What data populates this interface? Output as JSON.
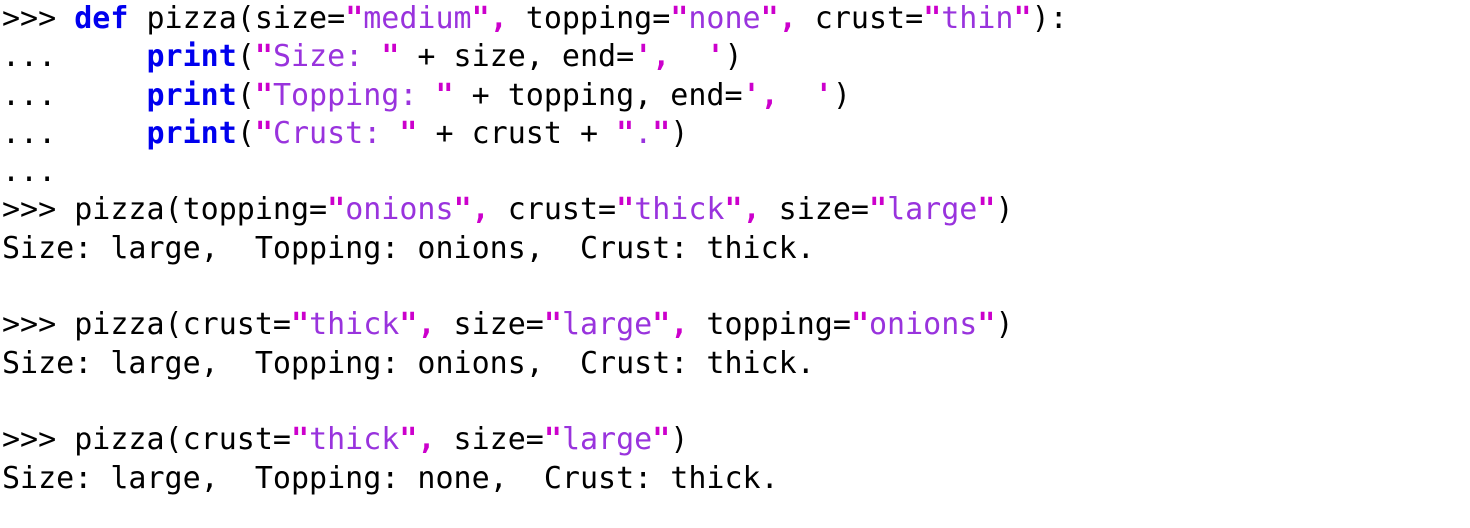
{
  "console": {
    "background_color": "#ffffff",
    "colors": {
      "plain": "#000000",
      "keyword": "#0000ee",
      "quote": "#cc00cc",
      "string": "#9933dd",
      "output": "#000000"
    },
    "prompt_primary": ">>> ",
    "prompt_continuation": "... ",
    "lines": [
      {
        "id": "line-1",
        "kind": "input",
        "text": ">>> def pizza(size=\"medium\", topping=\"none\", crust=\"thin\"):",
        "tokens": [
          {
            "t": ">>> ",
            "c": "prompt"
          },
          {
            "t": "def",
            "c": "keyword"
          },
          {
            "t": " pizza(size=",
            "c": "plain"
          },
          {
            "t": "\"",
            "c": "quote"
          },
          {
            "t": "medium",
            "c": "string"
          },
          {
            "t": "\"",
            "c": "quote"
          },
          {
            "t": ",",
            "c": "quote"
          },
          {
            "t": " topping=",
            "c": "plain"
          },
          {
            "t": "\"",
            "c": "quote"
          },
          {
            "t": "none",
            "c": "string"
          },
          {
            "t": "\"",
            "c": "quote"
          },
          {
            "t": ",",
            "c": "quote"
          },
          {
            "t": " crust=",
            "c": "plain"
          },
          {
            "t": "\"",
            "c": "quote"
          },
          {
            "t": "thin",
            "c": "string"
          },
          {
            "t": "\"",
            "c": "quote"
          },
          {
            "t": "):",
            "c": "plain"
          }
        ]
      },
      {
        "id": "line-2",
        "kind": "input",
        "text": "...     print(\"Size: \" + size, end=',  ')",
        "tokens": [
          {
            "t": "... ",
            "c": "prompt"
          },
          {
            "t": "    ",
            "c": "plain"
          },
          {
            "t": "print",
            "c": "keyword"
          },
          {
            "t": "(",
            "c": "plain"
          },
          {
            "t": "\"",
            "c": "quote"
          },
          {
            "t": "Size: ",
            "c": "string"
          },
          {
            "t": "\"",
            "c": "quote"
          },
          {
            "t": " + size, end=",
            "c": "plain"
          },
          {
            "t": "'",
            "c": "quote"
          },
          {
            "t": ",",
            "c": "quote"
          },
          {
            "t": "  ",
            "c": "string"
          },
          {
            "t": "'",
            "c": "quote"
          },
          {
            "t": ")",
            "c": "plain"
          }
        ]
      },
      {
        "id": "line-3",
        "kind": "input",
        "text": "...     print(\"Topping: \" + topping, end=',  ')",
        "tokens": [
          {
            "t": "... ",
            "c": "prompt"
          },
          {
            "t": "    ",
            "c": "plain"
          },
          {
            "t": "print",
            "c": "keyword"
          },
          {
            "t": "(",
            "c": "plain"
          },
          {
            "t": "\"",
            "c": "quote"
          },
          {
            "t": "Topping: ",
            "c": "string"
          },
          {
            "t": "\"",
            "c": "quote"
          },
          {
            "t": " + topping, end=",
            "c": "plain"
          },
          {
            "t": "'",
            "c": "quote"
          },
          {
            "t": ",",
            "c": "quote"
          },
          {
            "t": "  ",
            "c": "string"
          },
          {
            "t": "'",
            "c": "quote"
          },
          {
            "t": ")",
            "c": "plain"
          }
        ]
      },
      {
        "id": "line-4",
        "kind": "input",
        "text": "...     print(\"Crust: \" + crust + \".\")",
        "tokens": [
          {
            "t": "... ",
            "c": "prompt"
          },
          {
            "t": "    ",
            "c": "plain"
          },
          {
            "t": "print",
            "c": "keyword"
          },
          {
            "t": "(",
            "c": "plain"
          },
          {
            "t": "\"",
            "c": "quote"
          },
          {
            "t": "Crust: ",
            "c": "string"
          },
          {
            "t": "\"",
            "c": "quote"
          },
          {
            "t": " + crust + ",
            "c": "plain"
          },
          {
            "t": "\"",
            "c": "quote"
          },
          {
            "t": ".",
            "c": "string"
          },
          {
            "t": "\"",
            "c": "quote"
          },
          {
            "t": ")",
            "c": "plain"
          }
        ]
      },
      {
        "id": "line-5",
        "kind": "input",
        "text": "...",
        "tokens": [
          {
            "t": "...",
            "c": "prompt"
          }
        ]
      },
      {
        "id": "line-6",
        "kind": "input",
        "text": ">>> pizza(topping=\"onions\", crust=\"thick\", size=\"large\")",
        "tokens": [
          {
            "t": ">>> ",
            "c": "prompt"
          },
          {
            "t": "pizza(topping=",
            "c": "plain"
          },
          {
            "t": "\"",
            "c": "quote"
          },
          {
            "t": "onions",
            "c": "string"
          },
          {
            "t": "\"",
            "c": "quote"
          },
          {
            "t": ",",
            "c": "quote"
          },
          {
            "t": " crust=",
            "c": "plain"
          },
          {
            "t": "\"",
            "c": "quote"
          },
          {
            "t": "thick",
            "c": "string"
          },
          {
            "t": "\"",
            "c": "quote"
          },
          {
            "t": ",",
            "c": "quote"
          },
          {
            "t": " size=",
            "c": "plain"
          },
          {
            "t": "\"",
            "c": "quote"
          },
          {
            "t": "large",
            "c": "string"
          },
          {
            "t": "\"",
            "c": "quote"
          },
          {
            "t": ")",
            "c": "plain"
          }
        ]
      },
      {
        "id": "line-7",
        "kind": "output",
        "text": "Size: large,  Topping: onions,  Crust: thick.",
        "tokens": [
          {
            "t": "Size: large,  Topping: onions,  Crust: thick.",
            "c": "output"
          }
        ]
      },
      {
        "id": "line-8",
        "kind": "blank",
        "text": "",
        "tokens": []
      },
      {
        "id": "line-9",
        "kind": "input",
        "text": ">>> pizza(crust=\"thick\", size=\"large\", topping=\"onions\")",
        "tokens": [
          {
            "t": ">>> ",
            "c": "prompt"
          },
          {
            "t": "pizza(crust=",
            "c": "plain"
          },
          {
            "t": "\"",
            "c": "quote"
          },
          {
            "t": "thick",
            "c": "string"
          },
          {
            "t": "\"",
            "c": "quote"
          },
          {
            "t": ",",
            "c": "quote"
          },
          {
            "t": " size=",
            "c": "plain"
          },
          {
            "t": "\"",
            "c": "quote"
          },
          {
            "t": "large",
            "c": "string"
          },
          {
            "t": "\"",
            "c": "quote"
          },
          {
            "t": ",",
            "c": "quote"
          },
          {
            "t": " topping=",
            "c": "plain"
          },
          {
            "t": "\"",
            "c": "quote"
          },
          {
            "t": "onions",
            "c": "string"
          },
          {
            "t": "\"",
            "c": "quote"
          },
          {
            "t": ")",
            "c": "plain"
          }
        ]
      },
      {
        "id": "line-10",
        "kind": "output",
        "text": "Size: large,  Topping: onions,  Crust: thick.",
        "tokens": [
          {
            "t": "Size: large,  Topping: onions,  Crust: thick.",
            "c": "output"
          }
        ]
      },
      {
        "id": "line-11",
        "kind": "blank",
        "text": "",
        "tokens": []
      },
      {
        "id": "line-12",
        "kind": "input",
        "text": ">>> pizza(crust=\"thick\", size=\"large\")",
        "tokens": [
          {
            "t": ">>> ",
            "c": "prompt"
          },
          {
            "t": "pizza(crust=",
            "c": "plain"
          },
          {
            "t": "\"",
            "c": "quote"
          },
          {
            "t": "thick",
            "c": "string"
          },
          {
            "t": "\"",
            "c": "quote"
          },
          {
            "t": ",",
            "c": "quote"
          },
          {
            "t": " size=",
            "c": "plain"
          },
          {
            "t": "\"",
            "c": "quote"
          },
          {
            "t": "large",
            "c": "string"
          },
          {
            "t": "\"",
            "c": "quote"
          },
          {
            "t": ")",
            "c": "plain"
          }
        ]
      },
      {
        "id": "line-13",
        "kind": "output",
        "text": "Size: large,  Topping: none,  Crust: thick.",
        "tokens": [
          {
            "t": "Size: large,  Topping: none,  Crust: thick.",
            "c": "output"
          }
        ]
      }
    ]
  }
}
